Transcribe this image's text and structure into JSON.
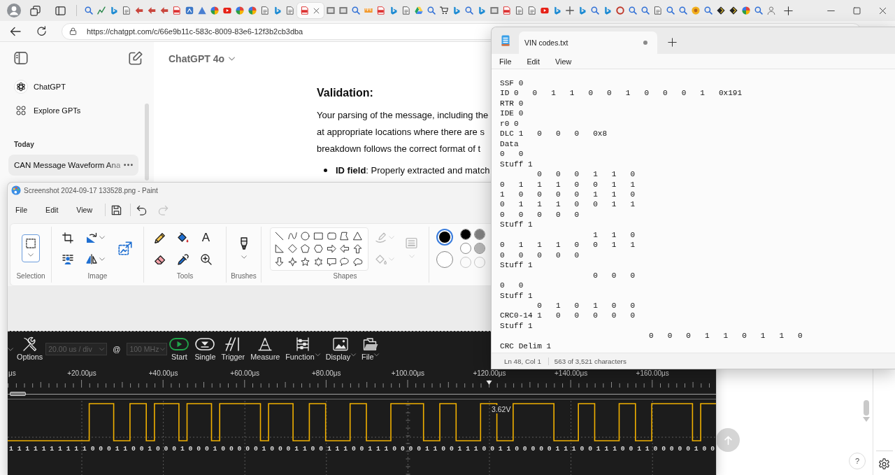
{
  "browser": {
    "tabs": [
      {
        "kind": "search",
        "selected": false
      },
      {
        "kind": "chart",
        "selected": false
      },
      {
        "kind": "ribbon",
        "selected": false
      },
      {
        "kind": "document",
        "selected": false
      },
      {
        "kind": "arrow",
        "selected": false
      },
      {
        "kind": "arrow",
        "selected": false
      },
      {
        "kind": "arrow",
        "selected": false
      },
      {
        "kind": "file",
        "selected": false
      },
      {
        "kind": "tile",
        "selected": false
      },
      {
        "kind": "triangle",
        "selected": false
      },
      {
        "kind": "quadrants",
        "selected": false
      },
      {
        "kind": "play",
        "selected": false
      },
      {
        "kind": "quadrants",
        "selected": false
      },
      {
        "kind": "quadrants",
        "selected": false
      },
      {
        "kind": "document",
        "selected": false
      },
      {
        "kind": "ribbon",
        "selected": false
      },
      {
        "kind": "document",
        "selected": false
      },
      {
        "kind": "file",
        "selected": true
      },
      {
        "kind": "box",
        "selected": false
      },
      {
        "kind": "box",
        "selected": false
      },
      {
        "kind": "search",
        "selected": false
      },
      {
        "kind": "ruler",
        "selected": false
      },
      {
        "kind": "file",
        "selected": false
      },
      {
        "kind": "ribbon",
        "selected": false
      },
      {
        "kind": "document",
        "selected": false
      },
      {
        "kind": "drive",
        "selected": false
      },
      {
        "kind": "search",
        "selected": false
      },
      {
        "kind": "cart",
        "selected": false
      },
      {
        "kind": "ribbon",
        "selected": false
      },
      {
        "kind": "search",
        "selected": false
      },
      {
        "kind": "ribbon",
        "selected": false
      },
      {
        "kind": "box",
        "selected": false
      },
      {
        "kind": "file",
        "selected": false
      },
      {
        "kind": "document",
        "selected": false
      },
      {
        "kind": "document",
        "selected": false
      },
      {
        "kind": "play",
        "selected": false
      },
      {
        "kind": "ribbon",
        "selected": false
      },
      {
        "kind": "cross",
        "selected": false
      },
      {
        "kind": "ribbon",
        "selected": false
      },
      {
        "kind": "search",
        "selected": false
      },
      {
        "kind": "ribbon",
        "selected": false
      },
      {
        "kind": "ring",
        "selected": false
      },
      {
        "kind": "search",
        "selected": false
      },
      {
        "kind": "search",
        "selected": false
      },
      {
        "kind": "document",
        "selected": false
      },
      {
        "kind": "search",
        "selected": false
      },
      {
        "kind": "search",
        "selected": false
      },
      {
        "kind": "disc",
        "selected": false
      },
      {
        "kind": "search",
        "selected": false
      },
      {
        "kind": "diamond",
        "selected": false
      },
      {
        "kind": "diamond",
        "selected": false
      },
      {
        "kind": "quadrants",
        "selected": false
      },
      {
        "kind": "search",
        "selected": false
      },
      {
        "kind": "person",
        "selected": false
      }
    ],
    "address": "https://chatgpt.com/c/66e9b11c-583c-8009-83e6-12f3b2cb3dba"
  },
  "chatgpt": {
    "sidebar": {
      "items": [
        {
          "kind": "logo",
          "label": "ChatGPT"
        },
        {
          "kind": "grid",
          "label": "Explore GPTs"
        }
      ],
      "section": "Today",
      "chats": [
        {
          "title": "CAN Message Waveform Ana",
          "selected": true
        }
      ]
    },
    "model": "ChatGPT 4o",
    "heading": "Validation:",
    "paragraph_lines": [
      "Your parsing of the message, including the",
      "at appropriate locations where there are s",
      "breakdown follows the correct format of t"
    ],
    "bullets": [
      "**ID field**: Properly extracted and match"
    ],
    "help": "?"
  },
  "paint": {
    "title": "Screenshot 2024-09-17 133528.png - Paint",
    "menu": [
      "File",
      "Edit",
      "View"
    ],
    "quick_actions": [
      {
        "kind": "save",
        "disabled": false
      },
      {
        "kind": "undo",
        "disabled": false
      },
      {
        "kind": "redo",
        "disabled": true
      }
    ],
    "ribbon": [
      {
        "kind": "selection",
        "label": "Selection",
        "tools": [
          {
            "kind": "select",
            "menu": true
          }
        ]
      },
      {
        "kind": "image",
        "label": "Image",
        "tools": [
          {
            "kind": "crop",
            "menu": false
          },
          {
            "kind": "rotate",
            "menu": true
          },
          {
            "kind": "resize",
            "menu": false
          },
          {
            "kind": "remove-background",
            "menu": false
          },
          {
            "kind": "flip",
            "menu": true
          }
        ]
      },
      {
        "kind": "tools",
        "label": "Tools",
        "tools": [
          {
            "kind": "pencil",
            "menu": false
          },
          {
            "kind": "fill",
            "menu": false
          },
          {
            "kind": "text",
            "menu": false,
            "glyph": "A"
          },
          {
            "kind": "eraser",
            "menu": false
          },
          {
            "kind": "picker",
            "menu": false
          },
          {
            "kind": "magnifier",
            "menu": false
          }
        ]
      },
      {
        "kind": "brushes",
        "label": "Brushes",
        "tools": [
          {
            "kind": "brush",
            "menu": true
          }
        ]
      },
      {
        "kind": "shapes",
        "label": "Shapes",
        "tools": [
          {
            "kind": "outline",
            "menu": true,
            "disabled": true
          },
          {
            "kind": "shape-fill",
            "menu": true,
            "disabled": true
          },
          {
            "kind": "size",
            "menu": true,
            "disabled": true
          }
        ]
      }
    ],
    "shapes": [
      {
        "kind": "line"
      },
      {
        "kind": "curve"
      },
      {
        "kind": "oval"
      },
      {
        "kind": "rectangle"
      },
      {
        "kind": "rounded-rectangle"
      },
      {
        "kind": "polygon"
      },
      {
        "kind": "triangle"
      },
      {
        "kind": "right-triangle"
      },
      {
        "kind": "diamond"
      },
      {
        "kind": "pentagon"
      },
      {
        "kind": "hexagon"
      },
      {
        "kind": "arrow-right"
      },
      {
        "kind": "arrow-left"
      },
      {
        "kind": "arrow-up"
      },
      {
        "kind": "arrow-down"
      },
      {
        "kind": "star-4"
      },
      {
        "kind": "star-5"
      },
      {
        "kind": "star-6"
      },
      {
        "kind": "callout-rectangle"
      },
      {
        "kind": "callout-oval"
      },
      {
        "kind": "callout-cloud"
      }
    ],
    "current_colors": [
      {
        "color": "#000000",
        "selected": true
      },
      {
        "color": "#ffffff",
        "selected": false
      }
    ],
    "palette": [
      {
        "kind": "swatch",
        "color": "#000000"
      },
      {
        "kind": "swatch",
        "color": "#7f7f7f"
      },
      {
        "kind": "swatch",
        "color": "#ffffff"
      },
      {
        "kind": "swatch",
        "color": "#b4b4b4"
      },
      {
        "kind": "empty"
      },
      {
        "kind": "empty"
      }
    ],
    "scope": {
      "options": "Options",
      "timebase": {
        "value": "20.00 us / div",
        "disabled": true
      },
      "at": "@",
      "rate": {
        "value": "100 MHz",
        "disabled": true
      },
      "buttons": [
        {
          "kind": "start",
          "label": "Start",
          "menu": false
        },
        {
          "kind": "single",
          "label": "Single",
          "menu": false
        },
        {
          "kind": "trigger",
          "label": "Trigger",
          "menu": false
        },
        {
          "kind": "measure",
          "label": "Measure",
          "menu": false
        },
        {
          "kind": "function",
          "label": "Function",
          "menu": true
        },
        {
          "kind": "display",
          "label": "Display",
          "menu": true
        },
        {
          "kind": "file",
          "label": "File",
          "menu": true
        }
      ],
      "ruler": [
        "μs",
        "+20.00μs",
        "+40.00μs",
        "+60.00μs",
        "+80.00μs",
        "+100.00μs",
        "+120.00μs",
        "+140.00μs",
        "+160.00μs"
      ],
      "cursor_reading": "3.62V",
      "bits": "1 1 1 1 1 1 1 1 1 1 0 0 0 1 1 0 0 1 0 0 0 1 0 0 0 1 0 0 0 0 0 1 0 0 0 1 1 0 0 1 1 1 0 0 1 1 1 0 0 0 0 1 1 0 0 1 1 1 0 0 1 1 0 0 0 0 0 1 1 1 0 0 1 1 1 0 0 1 1 0 0 0 0 0 1 0 0"
    }
  },
  "notepad": {
    "tab": {
      "title": "VIN codes.txt",
      "selected": true,
      "modified": true
    },
    "menu": [
      "File",
      "Edit",
      "View"
    ],
    "lines": [
      "SSF 0",
      "ID 0   0   1   1   0   0   1   0   0   0   1   0x191",
      "RTR 0",
      "IDE 0",
      "r0 0",
      "DLC 1   0   0   0   0x8",
      "Data",
      "0   0",
      "Stuff 1",
      "        0   0   0   1   1   0",
      "0   1   1   1   0   0   1   1",
      "1   0   0   0   0   1   1   0",
      "0   1   1   1   0   0   1   1",
      "0   0   0   0   0",
      "Stuff 1",
      "                    1   1   0",
      "0   1   1   1   0   0   1   1",
      "0   0   0   0   0",
      "Stuff 1",
      "                    0   0   0",
      "0   0",
      "Stuff 1",
      "        0   1   0   1   0   0",
      "CRC0-14 1   0   0   0   0   0",
      "Stuff 1",
      "                                0   0   0   1   1   0   1   1   0",
      "CRC Delim 1"
    ],
    "status": [
      "Ln 48, Col 1",
      "563 of 3,521 characters"
    ]
  }
}
